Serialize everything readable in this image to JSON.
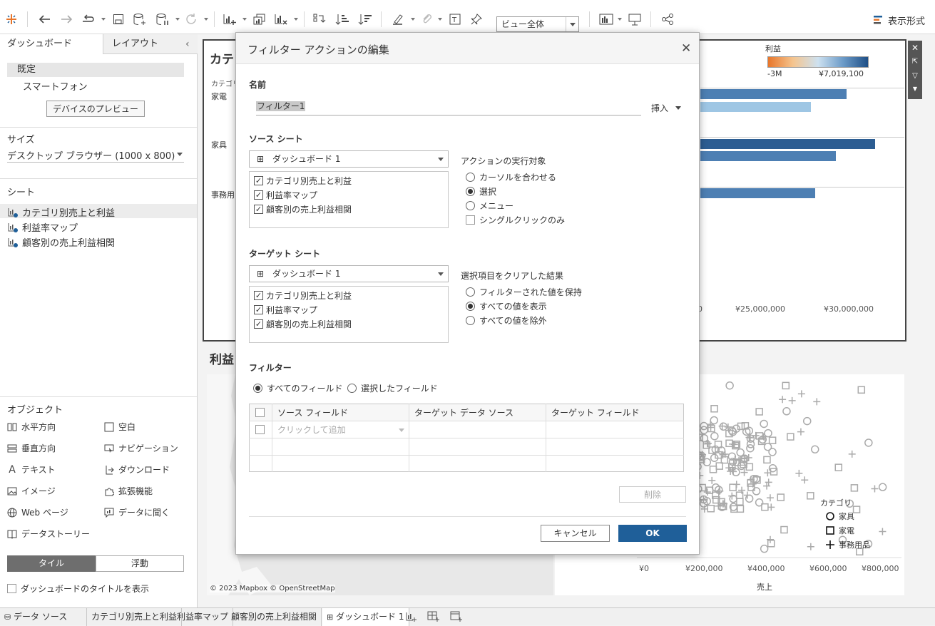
{
  "toolbar": {
    "view_select": "ビュー全体",
    "show_me": "表示形式"
  },
  "left_pane": {
    "tab_dashboard": "ダッシュボード",
    "tab_layout": "レイアウト",
    "device_default": "既定",
    "device_phone": "スマートフォン",
    "preview_button": "デバイスのプレビュー",
    "size_title": "サイズ",
    "size_value": "デスクトップ ブラウザー (1000 x 800)",
    "sheets_title": "シート",
    "sheets": [
      "カテゴリ別売上と利益",
      "利益率マップ",
      "顧客別の売上利益相関"
    ],
    "objects_title": "オブジェクト",
    "objects": [
      "水平方向",
      "空白",
      "垂直方向",
      "ナビゲーション",
      "テキスト",
      "ダウンロード",
      "イメージ",
      "拡張機能",
      "Web ページ",
      "データに聞く",
      "データストーリー"
    ],
    "tile": "タイル",
    "float": "浮動",
    "show_title": "ダッシュボードのタイトルを表示"
  },
  "dashboard": {
    "bar_title": "カテゴ",
    "category_header": "カテゴリ",
    "categories": [
      "家電",
      "家具",
      "事務用"
    ],
    "legend_title": "利益",
    "legend_min": "-3M",
    "legend_max": "¥7,019,100",
    "axis_ticks": [
      "¥25,000,000",
      "¥30,000,000"
    ],
    "axis_partial": "0",
    "map_title": "利益",
    "map_credit": "© 2023 Mapbox © OpenStreetMap",
    "scatter_x_ticks": [
      "¥0",
      "¥200,000",
      "¥400,000",
      "¥600,000",
      "¥800,000"
    ],
    "scatter_x_label": "売上",
    "scatter_legend_title": "カテゴリ",
    "scatter_legend": [
      "家具",
      "家電",
      "事務用品"
    ]
  },
  "dialog": {
    "title": "フィルター アクションの編集",
    "name_label": "名前",
    "name_value": "フィルター1",
    "insert": "挿入",
    "source_label": "ソース シート",
    "source_combo": "ダッシュボード 1",
    "source_sheets": [
      "カテゴリ別売上と利益",
      "利益率マップ",
      "顧客別の売上利益相関"
    ],
    "run_on_label": "アクションの実行対象",
    "run_on": [
      "カーソルを合わせる",
      "選択",
      "メニュー"
    ],
    "single_click": "シングルクリックのみ",
    "target_label": "ターゲット シート",
    "target_combo": "ダッシュボード 1",
    "target_sheets": [
      "カテゴリ別売上と利益",
      "利益率マップ",
      "顧客別の売上利益相関"
    ],
    "clear_label": "選択項目をクリアした結果",
    "clear_options": [
      "フィルターされた値を保持",
      "すべての値を表示",
      "すべての値を除外"
    ],
    "filter_label": "フィルター",
    "filter_all": "すべてのフィールド",
    "filter_selected": "選択したフィールド",
    "table_headers": [
      "ソース フィールド",
      "ターゲット データ ソース",
      "ターゲット フィールド"
    ],
    "add_placeholder": "クリックして追加",
    "delete": "削除",
    "cancel": "キャンセル",
    "ok": "OK"
  },
  "bottom_tabs": [
    "データ ソース",
    "カテゴリ別売上と利益",
    "利益率マップ",
    "顧客別の売上利益相関",
    "ダッシュボード 1"
  ],
  "colors": {
    "accent": "#1f5f99",
    "bar_dark": "#2c5d92",
    "bar_mid": "#4d7fb3",
    "bar_light": "#9ec6e4"
  }
}
